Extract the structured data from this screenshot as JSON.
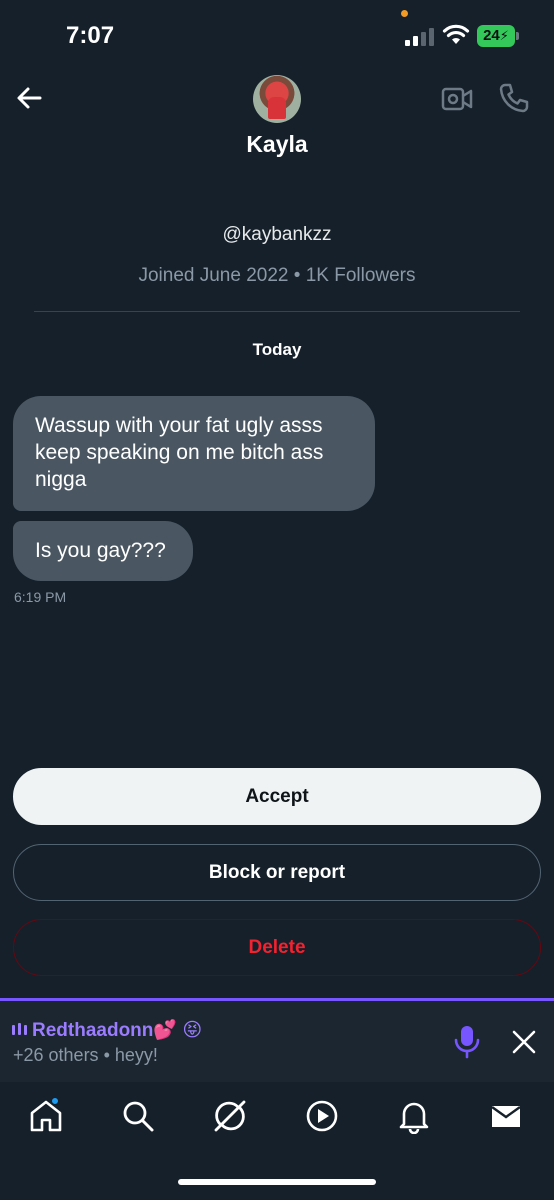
{
  "status_bar": {
    "time": "7:07",
    "battery": "24"
  },
  "header": {
    "contact_name": "Kayla",
    "back_icon": "arrow-left-icon",
    "video_icon": "video-camera-icon",
    "call_icon": "phone-icon"
  },
  "profile": {
    "handle": "@kaybankzz",
    "meta": "Joined June 2022 • 1K Followers"
  },
  "conversation": {
    "date_label": "Today",
    "messages": [
      {
        "text": "Wassup with your fat ugly asss keep speaking on me bitch ass nigga"
      },
      {
        "text": "Is you gay???"
      }
    ],
    "timestamp": "6:19 PM"
  },
  "request_actions": {
    "accept_label": "Accept",
    "block_label": "Block or report",
    "delete_label": "Delete"
  },
  "space_bar": {
    "host": "Redthaadonn💕 😝",
    "subtitle": "+26 others • heyy!",
    "accent_color": "#7856ff"
  },
  "bottom_nav": {
    "items": [
      "home-icon",
      "search-icon",
      "grok-icon",
      "video-icon",
      "notifications-icon",
      "messages-icon"
    ]
  },
  "colors": {
    "background": "#15202b",
    "bubble": "#4a5763",
    "delete_red": "#f4212e",
    "notification_dot": "#1d9bf0"
  }
}
